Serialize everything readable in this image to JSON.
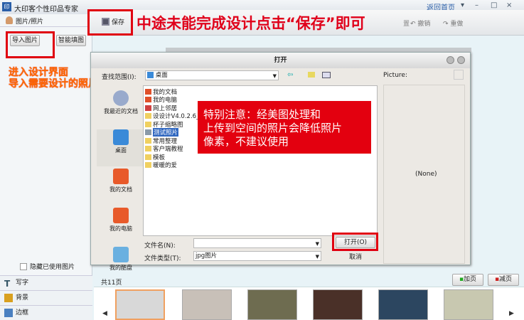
{
  "app": {
    "title": "大印客个性印品专家",
    "home_link": "返回首页"
  },
  "left_panel": {
    "section": "图片/照片",
    "import_button": "导入图片",
    "smart_fill_button": "智能填图",
    "hide_used_checkbox": "隐藏已使用图片",
    "tabs": [
      "写字",
      "背景",
      "边框"
    ]
  },
  "toolbar": {
    "save": "保存",
    "undo": "撤销",
    "redo": "重做",
    "partial_hidden_button": "置"
  },
  "annotations": {
    "save_hint": "中途未能完成设计点击“保存”即可",
    "import_hint_line1": "进入设计界面",
    "import_hint_line2": "导入需要设计的照片",
    "notice_line1": "特别注意：经美图处理和",
    "notice_line2": "上传到空间的照片会降低照片",
    "notice_line3": "像素，不建议使用"
  },
  "dialog": {
    "title": "打开",
    "look_in_label": "查找范围(I):",
    "look_in_value": "桌面",
    "picture_label": "Picture:",
    "preview_text": "(None)",
    "places": [
      "我最近的文档",
      "桌面",
      "我的文档",
      "我的电脑",
      "我的酷盘"
    ],
    "files": [
      "我的文档",
      "我的电脑",
      "网上邻居",
      "设设计V4.0.2.6_",
      "杯子缩略图",
      "测试照片",
      "常用整理",
      "客户端教程",
      "模板",
      "暖暖的爱"
    ],
    "selected_file": "测试照片",
    "filename_label": "文件名(N):",
    "filename_value": "",
    "filetype_label": "文件类型(T):",
    "filetype_value": "jpg图片",
    "open_button": "打开(O)",
    "cancel_button": "取消"
  },
  "pages": {
    "count_label": "共11页",
    "add_page": "加页",
    "remove_page": "减页"
  },
  "colors": {
    "annotation_red": "#e0001a",
    "accent_orange": "#ff6a00"
  }
}
